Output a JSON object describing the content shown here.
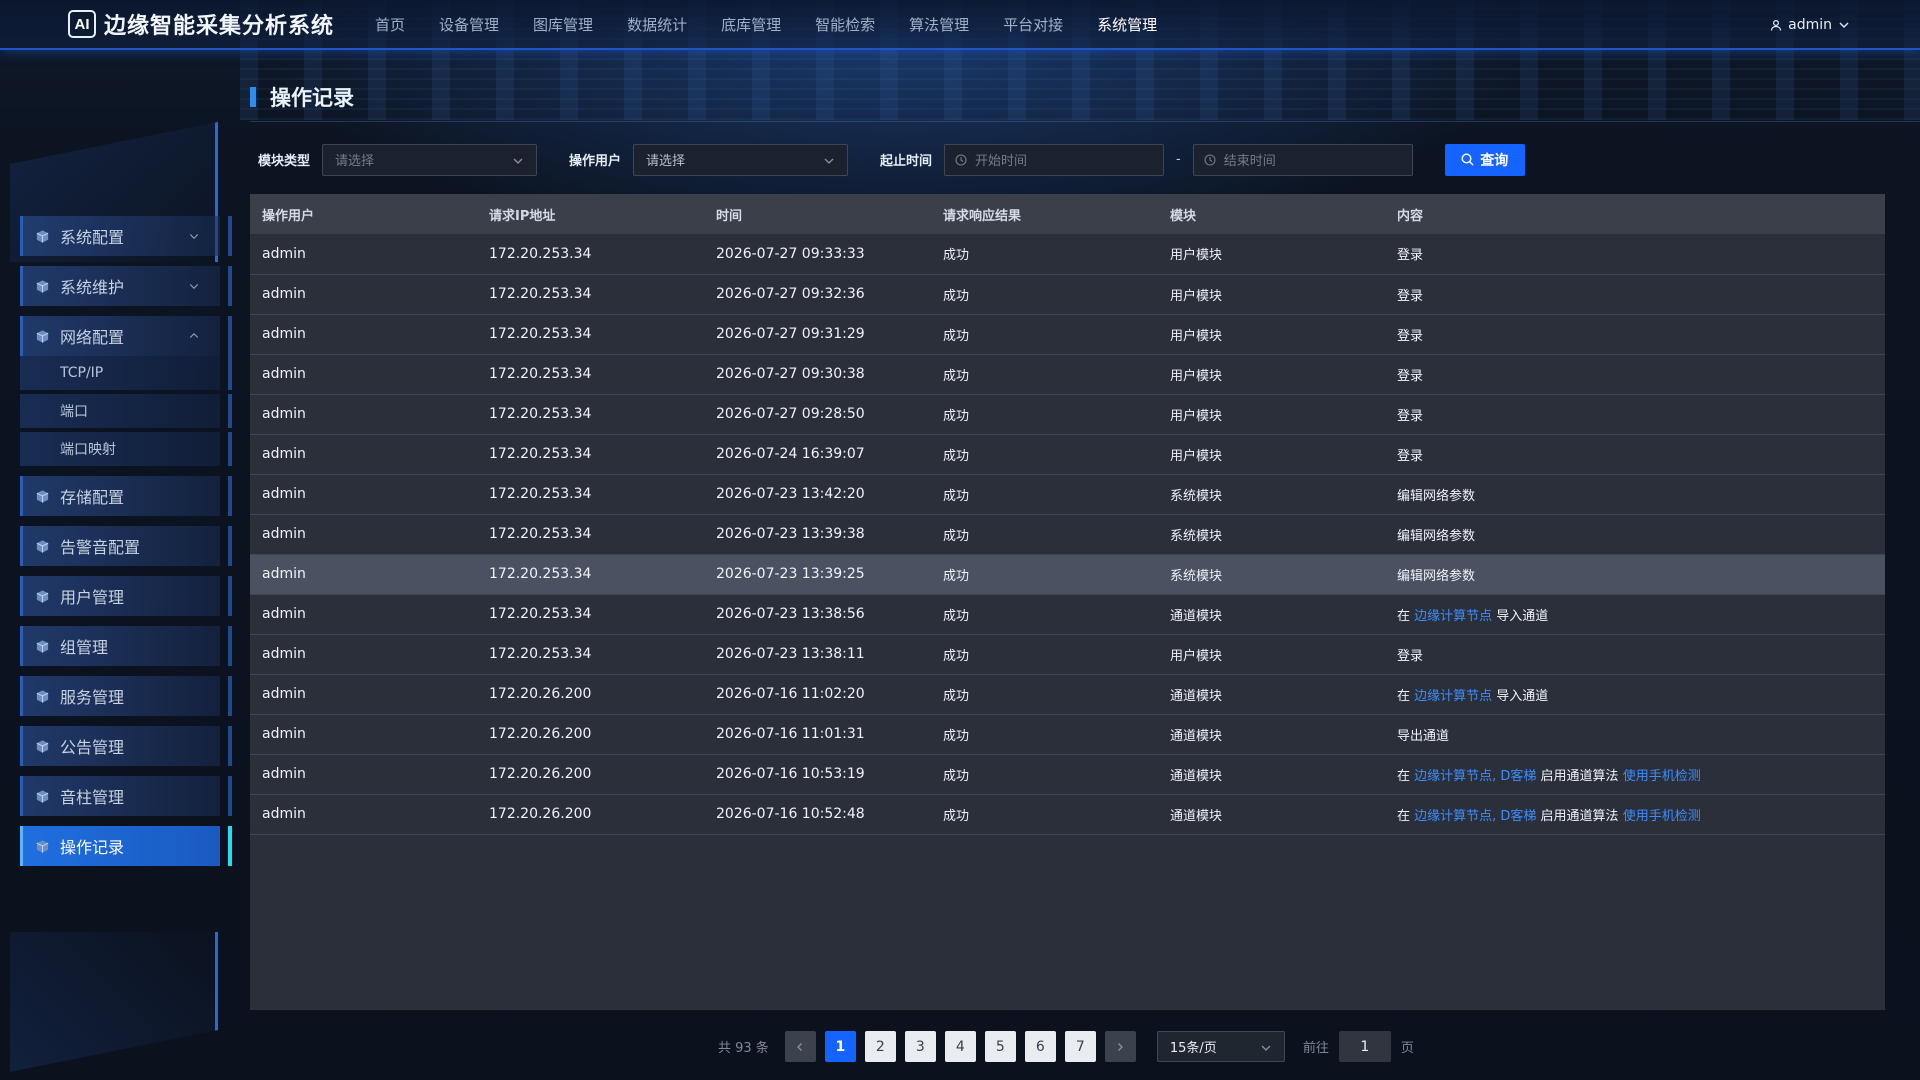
{
  "app": {
    "logo_text": "AI",
    "title": "边缘智能采集分析系统"
  },
  "nav": [
    "首页",
    "设备管理",
    "图库管理",
    "数据统计",
    "底库管理",
    "智能检索",
    "算法管理",
    "平台对接",
    "系统管理"
  ],
  "nav_active": 8,
  "user": {
    "name": "admin"
  },
  "sidebar": {
    "items": [
      {
        "label": "系统配置"
      },
      {
        "label": "系统维护"
      },
      {
        "label": "网络配置"
      },
      {
        "label": "存储配置"
      },
      {
        "label": "告警音配置"
      },
      {
        "label": "用户管理"
      },
      {
        "label": "组管理"
      },
      {
        "label": "服务管理"
      },
      {
        "label": "公告管理"
      },
      {
        "label": "音柱管理"
      },
      {
        "label": "操作记录"
      }
    ],
    "network_sub": [
      "TCP/IP",
      "端口",
      "端口映射"
    ],
    "active_label": "操作记录"
  },
  "page": {
    "title": "操作记录"
  },
  "filters": {
    "module_label": "模块类型",
    "module_placeholder": "请选择",
    "user_label": "操作用户",
    "user_value": "请选择",
    "time_label": "起止时间",
    "start_placeholder": "开始时间",
    "separator": "-",
    "end_placeholder": "结束时间",
    "query_label": "查询"
  },
  "table": {
    "columns": [
      "操作用户",
      "请求IP地址",
      "时间",
      "请求响应结果",
      "模块",
      "内容"
    ],
    "rows": [
      {
        "user": "admin",
        "ip": "172.20.253.34",
        "time": "2026-07-27 09:33:33",
        "result": "成功",
        "module": "用户模块",
        "content": [
          {
            "t": "登录"
          }
        ]
      },
      {
        "user": "admin",
        "ip": "172.20.253.34",
        "time": "2026-07-27 09:32:36",
        "result": "成功",
        "module": "用户模块",
        "content": [
          {
            "t": "登录"
          }
        ]
      },
      {
        "user": "admin",
        "ip": "172.20.253.34",
        "time": "2026-07-27 09:31:29",
        "result": "成功",
        "module": "用户模块",
        "content": [
          {
            "t": "登录"
          }
        ]
      },
      {
        "user": "admin",
        "ip": "172.20.253.34",
        "time": "2026-07-27 09:30:38",
        "result": "成功",
        "module": "用户模块",
        "content": [
          {
            "t": "登录"
          }
        ]
      },
      {
        "user": "admin",
        "ip": "172.20.253.34",
        "time": "2026-07-27 09:28:50",
        "result": "成功",
        "module": "用户模块",
        "content": [
          {
            "t": "登录"
          }
        ]
      },
      {
        "user": "admin",
        "ip": "172.20.253.34",
        "time": "2026-07-24 16:39:07",
        "result": "成功",
        "module": "用户模块",
        "content": [
          {
            "t": "登录"
          }
        ]
      },
      {
        "user": "admin",
        "ip": "172.20.253.34",
        "time": "2026-07-23 13:42:20",
        "result": "成功",
        "module": "系统模块",
        "content": [
          {
            "t": "编辑网络参数"
          }
        ]
      },
      {
        "user": "admin",
        "ip": "172.20.253.34",
        "time": "2026-07-23 13:39:38",
        "result": "成功",
        "module": "系统模块",
        "content": [
          {
            "t": "编辑网络参数"
          }
        ]
      },
      {
        "user": "admin",
        "ip": "172.20.253.34",
        "time": "2026-07-23 13:39:25",
        "result": "成功",
        "module": "系统模块",
        "content": [
          {
            "t": "编辑网络参数"
          }
        ],
        "highlight": true
      },
      {
        "user": "admin",
        "ip": "172.20.253.34",
        "time": "2026-07-23 13:38:56",
        "result": "成功",
        "module": "通道模块",
        "content": [
          {
            "t": "在 "
          },
          {
            "t": "边缘计算节点",
            "link": true
          },
          {
            "t": " 导入通道"
          }
        ]
      },
      {
        "user": "admin",
        "ip": "172.20.253.34",
        "time": "2026-07-23 13:38:11",
        "result": "成功",
        "module": "用户模块",
        "content": [
          {
            "t": "登录"
          }
        ]
      },
      {
        "user": "admin",
        "ip": "172.20.26.200",
        "time": "2026-07-16 11:02:20",
        "result": "成功",
        "module": "通道模块",
        "content": [
          {
            "t": "在 "
          },
          {
            "t": "边缘计算节点",
            "link": true
          },
          {
            "t": " 导入通道"
          }
        ]
      },
      {
        "user": "admin",
        "ip": "172.20.26.200",
        "time": "2026-07-16 11:01:31",
        "result": "成功",
        "module": "通道模块",
        "content": [
          {
            "t": "导出通道"
          }
        ]
      },
      {
        "user": "admin",
        "ip": "172.20.26.200",
        "time": "2026-07-16 10:53:19",
        "result": "成功",
        "module": "通道模块",
        "content": [
          {
            "t": "在 "
          },
          {
            "t": "边缘计算节点, D客梯",
            "link": true
          },
          {
            "t": " 启用通道算法 "
          },
          {
            "t": "使用手机检测",
            "link": true
          }
        ]
      },
      {
        "user": "admin",
        "ip": "172.20.26.200",
        "time": "2026-07-16 10:52:48",
        "result": "成功",
        "module": "通道模块",
        "content": [
          {
            "t": "在 "
          },
          {
            "t": "边缘计算节点, D客梯",
            "link": true
          },
          {
            "t": " 启用通道算法 "
          },
          {
            "t": "使用手机检测",
            "link": true
          }
        ]
      }
    ]
  },
  "pagination": {
    "total_text": "共 93 条",
    "pages": [
      "1",
      "2",
      "3",
      "4",
      "5",
      "6",
      "7"
    ],
    "current": "1",
    "page_size": "15条/页",
    "goto_label": "前往",
    "goto_value": "1",
    "goto_unit": "页"
  },
  "colors": {
    "accent": "#1664ff",
    "link": "#3d8dff",
    "active_bar": "#1ee0f0"
  },
  "icons": [
    "user-icon",
    "chevron-down-icon",
    "chevron-up-icon",
    "cube-icon",
    "clock-icon",
    "search-icon",
    "chevron-left-icon",
    "chevron-right-icon"
  ]
}
